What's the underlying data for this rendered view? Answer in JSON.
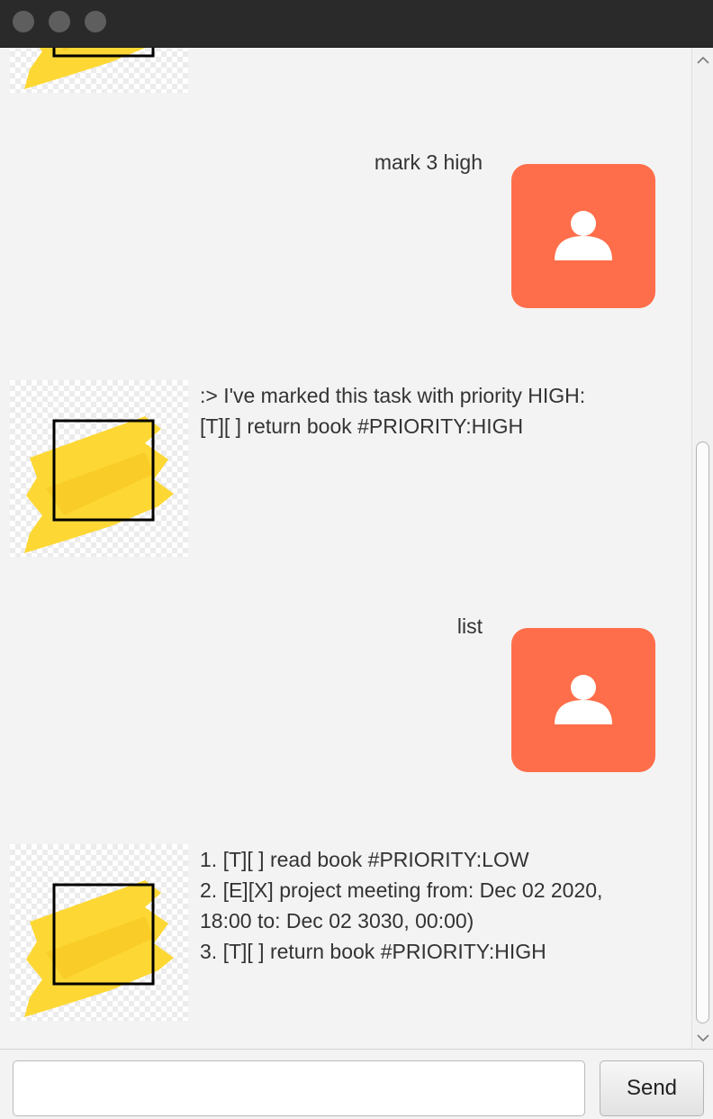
{
  "window": {
    "controls": [
      "close",
      "minimize",
      "zoom"
    ]
  },
  "dialog": {
    "top_partial": {
      "sender": "bot"
    },
    "exchanges": [
      {
        "user": {
          "text": "mark 3 high",
          "avatar": "user-avatar-icon"
        },
        "bot": {
          "avatar": "bot-avatar-icon",
          "lines": [
            ":> I've marked this task with priority HIGH:",
            "[T][ ] return book #PRIORITY:HIGH"
          ]
        }
      },
      {
        "user": {
          "text": "list",
          "avatar": "user-avatar-icon"
        },
        "bot": {
          "avatar": "bot-avatar-icon",
          "lines": [
            "1. [T][ ] read book #PRIORITY:LOW",
            "2. [E][X] project meeting from: Dec 02 2020,",
            "18:00 to: Dec 02 3030, 00:00)",
            "3. [T][ ] return book #PRIORITY:HIGH"
          ]
        }
      }
    ]
  },
  "input": {
    "value": "",
    "placeholder": ""
  },
  "send_button": {
    "label": "Send"
  },
  "colors": {
    "user_avatar_bg": "#ff6e4a",
    "bot_avatar_paint": "#fdd835",
    "background": "#f3f3f3",
    "titlebar": "#2a2a2a"
  }
}
